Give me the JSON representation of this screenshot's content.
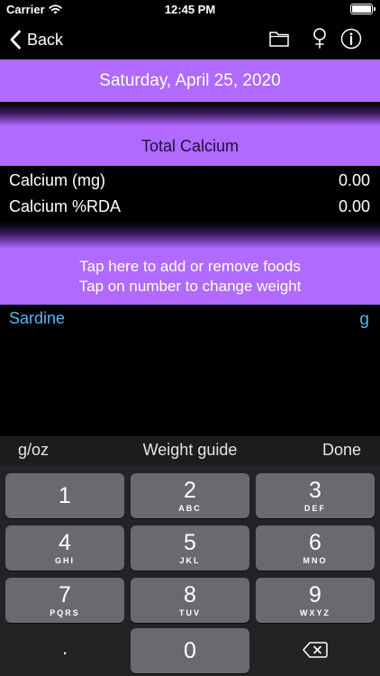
{
  "status_bar": {
    "carrier": "Carrier",
    "time": "12:45 PM"
  },
  "nav": {
    "back_label": "Back",
    "icons": [
      "folder-icon",
      "female-icon",
      "info-icon"
    ]
  },
  "date_label": "Saturday, April 25, 2020",
  "total_label": "Total Calcium",
  "nutrients": [
    {
      "label": "Calcium (mg)",
      "value": "0.00"
    },
    {
      "label": "Calcium %RDA",
      "value": "0.00"
    }
  ],
  "instructions": {
    "line1": "Tap here to add or remove foods",
    "line2": "Tap on number to change weight"
  },
  "foods": [
    {
      "name": "Sardine",
      "unit": "g"
    }
  ],
  "keyboard_toolbar": {
    "unit_toggle": "g/oz",
    "weight_guide": "Weight guide",
    "done": "Done"
  },
  "keypad": [
    {
      "digit": "1",
      "letters": ""
    },
    {
      "digit": "2",
      "letters": "ABC"
    },
    {
      "digit": "3",
      "letters": "DEF"
    },
    {
      "digit": "4",
      "letters": "GHI"
    },
    {
      "digit": "5",
      "letters": "JKL"
    },
    {
      "digit": "6",
      "letters": "MNO"
    },
    {
      "digit": "7",
      "letters": "PQRS"
    },
    {
      "digit": "8",
      "letters": "TUV"
    },
    {
      "digit": "9",
      "letters": "WXYZ"
    },
    {
      "digit": ".",
      "letters": ""
    },
    {
      "digit": "0",
      "letters": ""
    }
  ],
  "colors": {
    "accent_purple": "#b06aff",
    "food_blue": "#5ab4f0",
    "background": "#000000",
    "key_gray": "#6a6a6e"
  }
}
